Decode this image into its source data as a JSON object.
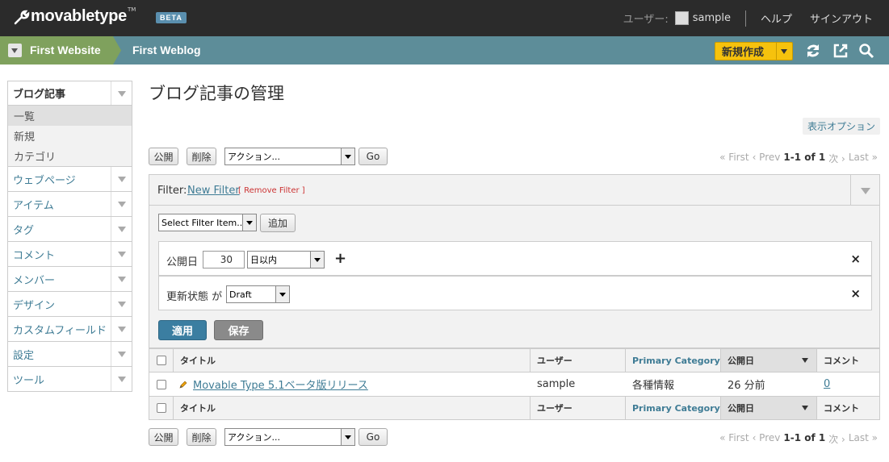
{
  "app": {
    "logo_text": "movabletype",
    "logo_tm": "TM",
    "beta": "BETA"
  },
  "topbar": {
    "user_label": "ユーザー:",
    "user_name": "sample",
    "help": "ヘルプ",
    "signout": "サインアウト"
  },
  "nav": {
    "website": "First Website",
    "blog": "First Weblog",
    "new_button": "新規作成"
  },
  "sidebar": {
    "active": {
      "label": "ブログ記事",
      "subitems": [
        "一覧",
        "新規",
        "カテゴリ"
      ]
    },
    "items": [
      "ウェブページ",
      "アイテム",
      "タグ",
      "コメント",
      "メンバー",
      "デザイン",
      "カスタムフィールド",
      "設定",
      "ツール"
    ]
  },
  "main": {
    "title": "ブログ記事の管理",
    "display_options": "表示オプション",
    "publish": "公開",
    "delete": "削除",
    "action_select": "アクション...",
    "go": "Go",
    "pager": {
      "first": "« First",
      "prev": "‹ Prev",
      "range": "1-1 of 1",
      "next": "次 ›",
      "last": "Last »"
    }
  },
  "filter": {
    "label": "Filter:",
    "new_filter": "New Filter",
    "remove_filter": "[ Remove Filter ]",
    "select_item": "Select Filter Item...",
    "add": "追加",
    "row1": {
      "label": "公開日",
      "value": "30",
      "unit_select": "日以内",
      "plus": "+",
      "remove": "×"
    },
    "row2": {
      "label": "更新状態 が",
      "status_select": "Draft",
      "remove": "×"
    },
    "apply": "適用",
    "save": "保存"
  },
  "table": {
    "headers": {
      "title": "タイトル",
      "user": "ユーザー",
      "category": "Primary Category",
      "date": "公開日",
      "comments": "コメント"
    },
    "rows": [
      {
        "title": "Movable Type 5.1ベータ版リリース",
        "user": "sample",
        "category": "各種情報",
        "date": "26 分前",
        "comments": "0"
      }
    ]
  },
  "colors": {
    "nav_bg": "#5d8d99",
    "website_bg": "#7fa15d",
    "link": "#3f7c95",
    "new_button": "#f6c20d",
    "apply": "#3b7ea1"
  }
}
